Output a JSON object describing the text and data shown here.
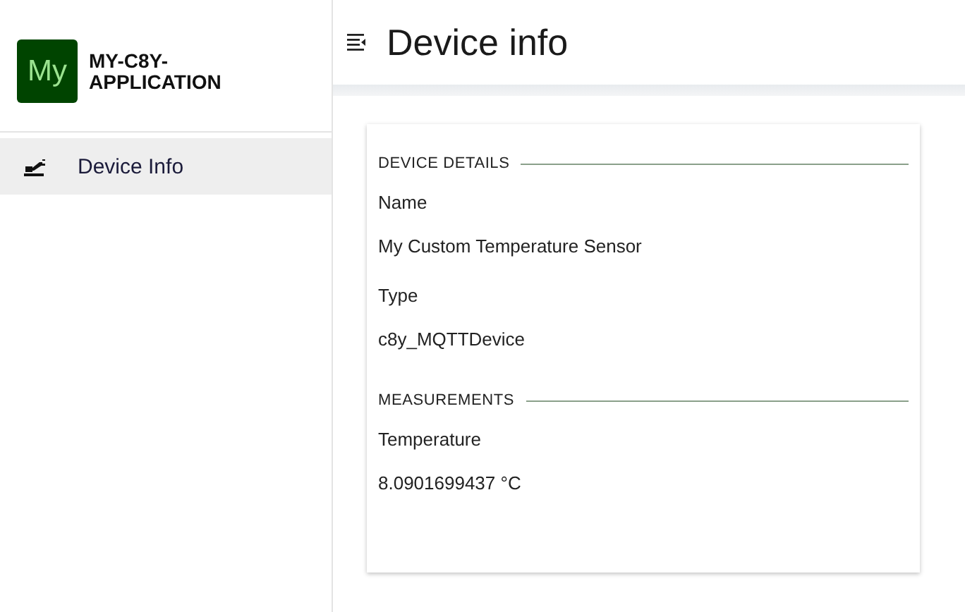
{
  "app": {
    "logo": "My",
    "title": "MY-C8Y-APPLICATION"
  },
  "sidebar": {
    "items": [
      {
        "label": "Device Info",
        "selected": true
      }
    ]
  },
  "header": {
    "title": "Device info"
  },
  "sections": [
    {
      "title": "DEVICE DETAILS",
      "fields": [
        {
          "label": "Name",
          "value": "My Custom Temperature Sensor"
        },
        {
          "label": "Type",
          "value": "c8y_MQTTDevice"
        }
      ]
    },
    {
      "title": "MEASUREMENTS",
      "fields": [
        {
          "label": "Temperature",
          "value": "8.0901699437 °C"
        }
      ]
    }
  ]
}
